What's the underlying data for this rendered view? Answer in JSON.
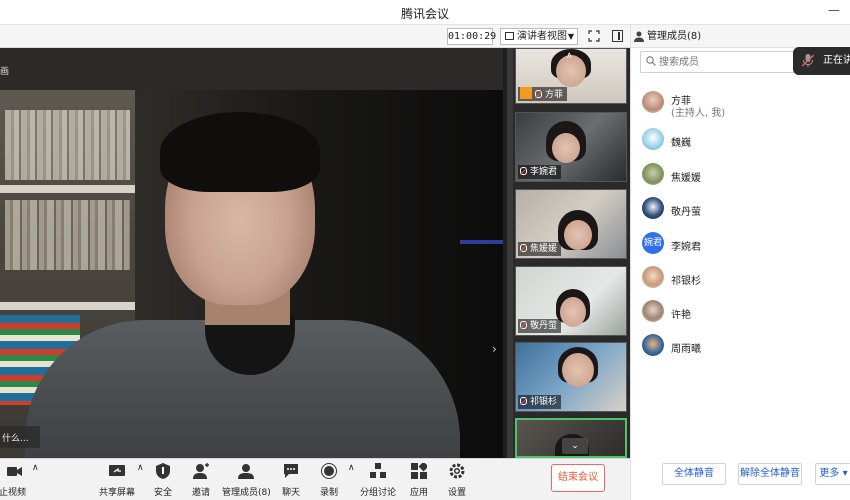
{
  "app": {
    "title": "腾讯会议"
  },
  "toolbar_top": {
    "timer": "01:00:29",
    "view_mode": "演讲者视图"
  },
  "main_video": {
    "corner_label": "画",
    "book_caption": "什么..."
  },
  "participant_strip": {
    "tiles": [
      {
        "name": "方菲",
        "is_host": true
      },
      {
        "name": "李婉君",
        "is_host": false
      },
      {
        "name": "焦媛媛",
        "is_host": false
      },
      {
        "name": "敬丹萤",
        "is_host": false
      },
      {
        "name": "祁银杉",
        "is_host": false
      },
      {
        "name": "",
        "is_host": false
      }
    ]
  },
  "bottom_toolbar": {
    "stop_video": "停止视频",
    "share_screen": "共享屏幕",
    "security": "安全",
    "invite": "邀请",
    "manage_members": "管理成员(8)",
    "chat": "聊天",
    "record": "录制",
    "breakout": "分组讨论",
    "apps": "应用",
    "settings": "设置",
    "end_meeting": "结束会议"
  },
  "members_panel": {
    "title": "管理成员(8)",
    "search_placeholder": "搜索成员",
    "speaking_label": "正在讲话",
    "members": [
      {
        "name": "方菲",
        "sub": "(主持人, 我)"
      },
      {
        "name": "魏巍",
        "sub": ""
      },
      {
        "name": "焦媛媛",
        "sub": ""
      },
      {
        "name": "敬丹萤",
        "sub": ""
      },
      {
        "name": "李婉君",
        "sub": "",
        "avatar_text": "婉君"
      },
      {
        "name": "祁银杉",
        "sub": ""
      },
      {
        "name": "许艳",
        "sub": ""
      },
      {
        "name": "周雨曦",
        "sub": ""
      }
    ],
    "mute_all": "全体静音",
    "unmute_all": "解除全体静音",
    "more": "更多"
  },
  "colors": {
    "accent_blue": "#1f5fd8",
    "end_red": "#e53333",
    "active_green": "#4cc46a",
    "host_orange": "#f39a1c"
  }
}
